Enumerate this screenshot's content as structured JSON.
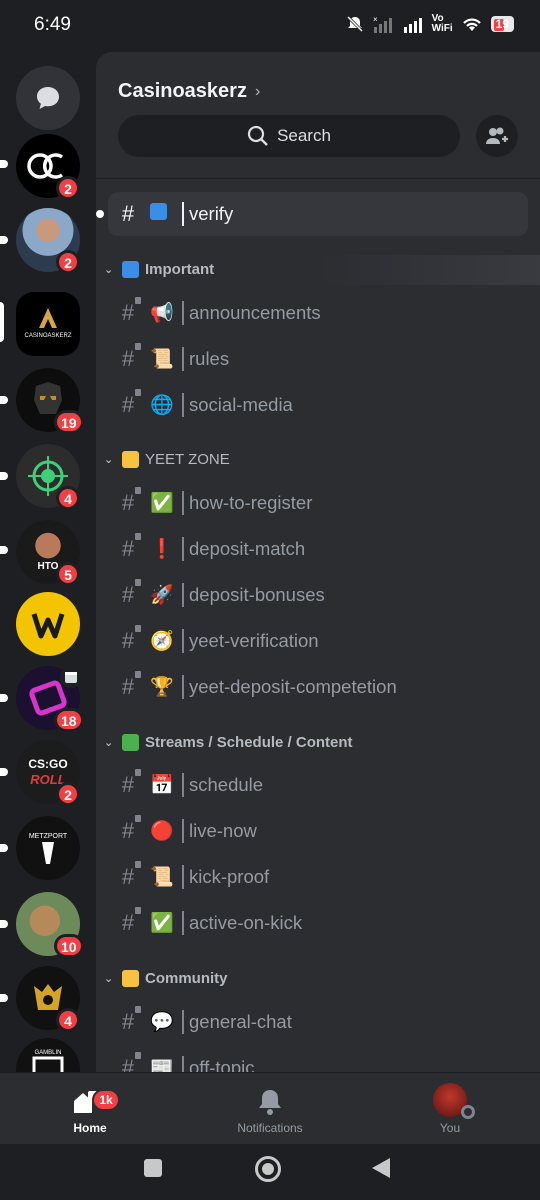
{
  "status_bar": {
    "time": "6:49",
    "network_label": "Vo\nWiFi",
    "battery": "19"
  },
  "rail": {
    "servers": [
      {
        "name": "dm",
        "badge": null,
        "bg": "#313338"
      },
      {
        "name": "ac",
        "badge": "2",
        "bg": "#000000",
        "glyph": "AC"
      },
      {
        "name": "avatar-man",
        "badge": "2",
        "bg": "#6a8fb5"
      },
      {
        "name": "casinoaskerz",
        "badge": null,
        "bg": "#000000",
        "glyph": "CASINOASKERZ"
      },
      {
        "name": "panther",
        "badge": "19",
        "bg": "#111111"
      },
      {
        "name": "target",
        "badge": "4",
        "bg": "#2a2a2a"
      },
      {
        "name": "hto",
        "badge": "5",
        "bg": "#1a1a1a",
        "glyph": "HTO"
      },
      {
        "name": "w-gold",
        "badge": null,
        "bg": "#f2c500",
        "glyph": "W"
      },
      {
        "name": "purple-event",
        "badge": "18",
        "bg": "#1b1030"
      },
      {
        "name": "csgo-roll",
        "badge": "2",
        "bg": "#1a1a1a",
        "glyph": "CS:GO ROLL"
      },
      {
        "name": "metzport",
        "badge": null,
        "bg": "#111111",
        "glyph": "METZPORT"
      },
      {
        "name": "dog",
        "badge": "10",
        "bg": "#8a7a5a"
      },
      {
        "name": "gold-crest",
        "badge": "4",
        "bg": "#111111"
      },
      {
        "name": "gamblin-hub",
        "badge": null,
        "bg": "#111111",
        "glyph": "GAMBLIN HUB"
      }
    ]
  },
  "panel": {
    "server_name": "Casinoaskerz",
    "search_label": "Search",
    "top_channel": {
      "name": "verify",
      "emoji": "🟦"
    },
    "categories": [
      {
        "title": "Important",
        "color": "#3a8ee6",
        "channels": [
          {
            "emoji": "📢",
            "name": "announcements"
          },
          {
            "emoji": "📜",
            "name": "rules"
          },
          {
            "emoji": "🌐",
            "name": "social-media"
          }
        ]
      },
      {
        "title": "YEET ZONE",
        "color": "#f5c242",
        "channels": [
          {
            "emoji": "✅",
            "name": "how-to-register"
          },
          {
            "emoji": "❗",
            "name": "deposit-match"
          },
          {
            "emoji": "🚀",
            "name": "deposit-bonuses"
          },
          {
            "emoji": "🧭",
            "name": "yeet-verification"
          },
          {
            "emoji": "🏆",
            "name": "yeet-deposit-competetion"
          }
        ]
      },
      {
        "title": "Streams / Schedule / Content",
        "color": "#4caf50",
        "channels": [
          {
            "emoji": "📅",
            "name": "schedule"
          },
          {
            "emoji": "🔴",
            "name": "live-now"
          },
          {
            "emoji": "📜",
            "name": "kick-proof"
          },
          {
            "emoji": "✅",
            "name": "active-on-kick"
          }
        ]
      },
      {
        "title": "Community",
        "color": "#f5c242",
        "channels": [
          {
            "emoji": "💬",
            "name": "general-chat"
          },
          {
            "emoji": "📰",
            "name": "off-topic"
          }
        ]
      }
    ]
  },
  "bottom_nav": {
    "home": "Home",
    "home_badge": "1k",
    "notifications": "Notifications",
    "you": "You"
  }
}
